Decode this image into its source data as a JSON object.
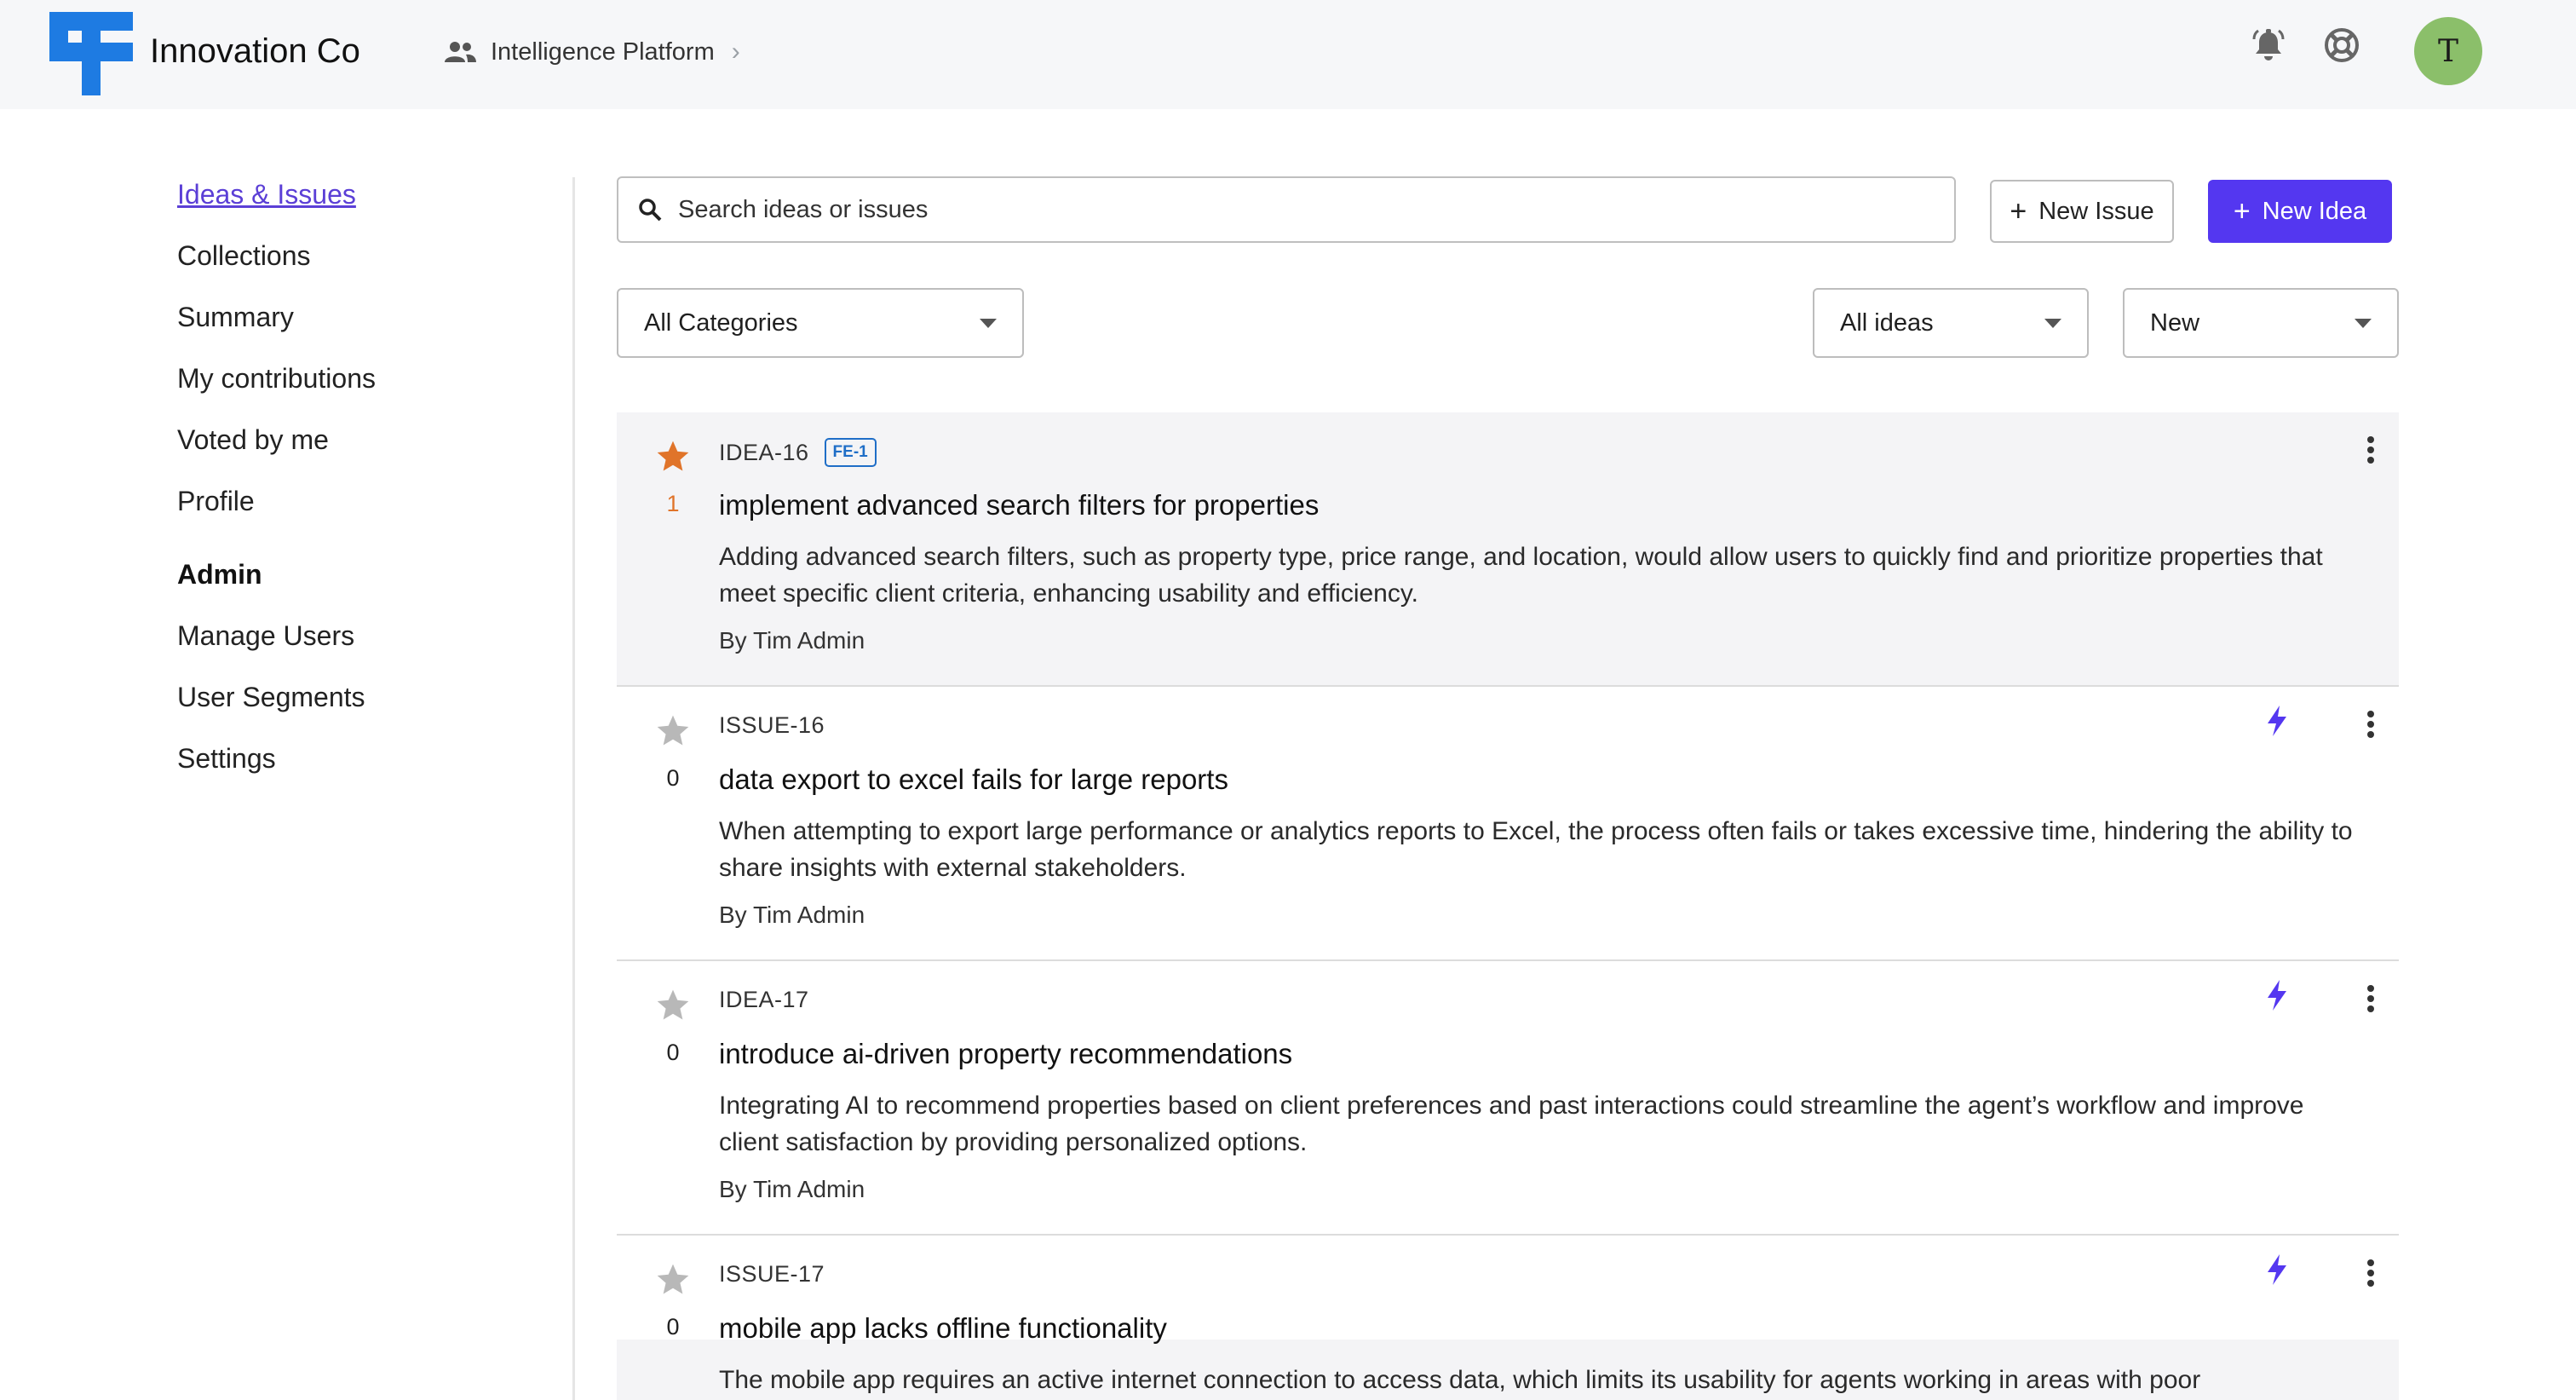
{
  "header": {
    "brand": "Innovation Co",
    "breadcrumb": "Intelligence Platform",
    "avatar_initial": "T"
  },
  "colors": {
    "accent": "#5437f0",
    "link": "#5b3fd6",
    "logo": "#1e7be2",
    "star_active": "#e0742a",
    "star_inactive": "#b8b8b8",
    "tag": "#1f6ec7",
    "avatar": "#8bbf6a"
  },
  "sidebar": {
    "items": [
      {
        "label": "Ideas & Issues"
      },
      {
        "label": "Collections"
      },
      {
        "label": "Summary"
      },
      {
        "label": "My contributions"
      },
      {
        "label": "Voted by me"
      },
      {
        "label": "Profile"
      }
    ],
    "admin_heading": "Admin",
    "admin_items": [
      {
        "label": "Manage Users"
      },
      {
        "label": "User Segments"
      },
      {
        "label": "Settings"
      }
    ]
  },
  "toolbar": {
    "search_placeholder": "Search ideas or issues",
    "new_issue_label": "New Issue",
    "new_idea_label": "New Idea",
    "category_filter": "All Categories",
    "type_filter": "All ideas",
    "sort_filter": "New"
  },
  "items": [
    {
      "key": "IDEA-16",
      "tag": "FE-1",
      "votes": "1",
      "title": "implement advanced search filters for properties",
      "description": "Adding advanced search filters, such as property type, price range, and location, would allow users to quickly find and prioritize properties that meet specific client criteria, enhancing usability and efficiency.",
      "author": "By Tim Admin"
    },
    {
      "key": "ISSUE-16",
      "votes": "0",
      "title": "data export to excel fails for large reports",
      "description": "When attempting to export large performance or analytics reports to Excel, the process often fails or takes excessive time, hindering the ability to share insights with external stakeholders.",
      "author": "By Tim Admin"
    },
    {
      "key": "IDEA-17",
      "votes": "0",
      "title": "introduce ai-driven property recommendations",
      "description": "Integrating AI to recommend properties based on client preferences and past interactions could streamline the agent’s workflow and improve client satisfaction by providing personalized options.",
      "author": "By Tim Admin"
    },
    {
      "key": "ISSUE-17",
      "votes": "0",
      "title": "mobile app lacks offline functionality",
      "description": "The mobile app requires an active internet connection to access data, which limits its usability for agents working in areas with poor"
    }
  ]
}
